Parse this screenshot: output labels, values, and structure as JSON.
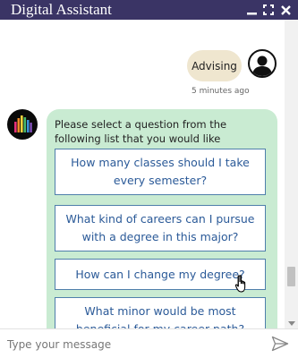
{
  "window": {
    "title": "Digital Assistant"
  },
  "user_message": {
    "text": "Advising",
    "timestamp": "5 minutes ago"
  },
  "bot_message": {
    "prompt": "Please select a question from the following list that you would like answered.",
    "options": [
      "How many classes should I take every semester?",
      "What kind of careers can I pursue with a degree in this major?",
      "How can I change my degree?",
      "What minor would be most beneficial for my career path?"
    ]
  },
  "input": {
    "placeholder": "Type your message"
  },
  "icons": {
    "minimize": "minimize-icon",
    "maximize": "maximize-icon",
    "close": "close-icon",
    "send": "send-icon",
    "user": "user-icon",
    "bot": "bot-logo-icon"
  },
  "colors": {
    "titlebar": "#3a3465",
    "bot_bubble": "#c9ebd2",
    "user_bubble": "#efe6cf",
    "option_text": "#2b5a98",
    "option_border": "#4f7fab"
  }
}
